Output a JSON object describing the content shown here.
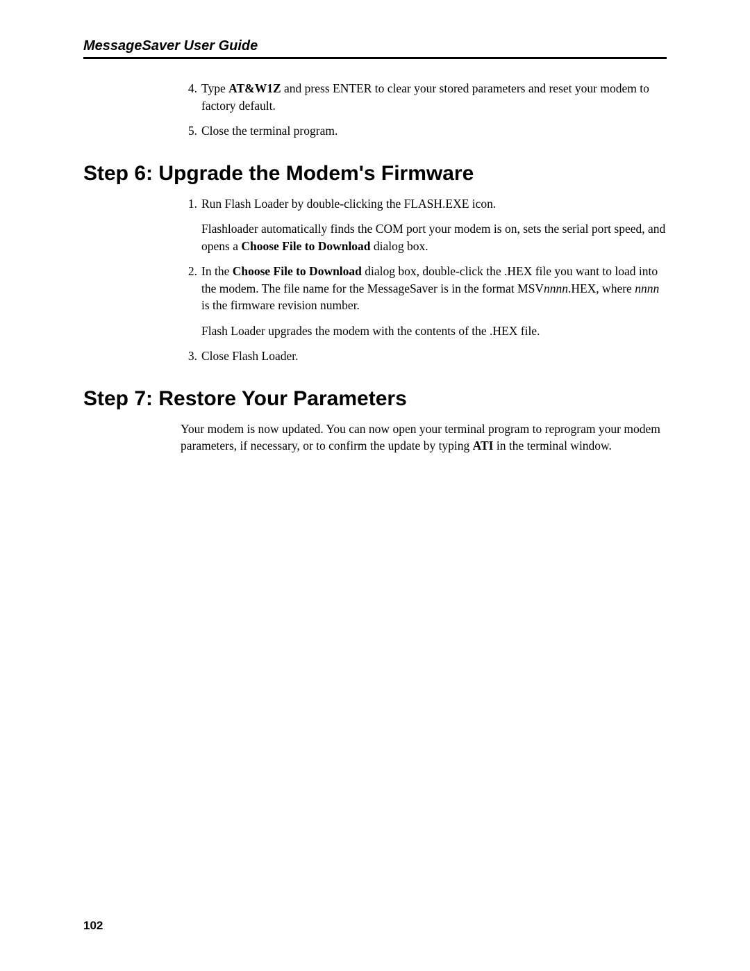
{
  "header": {
    "title": "MessageSaver User Guide"
  },
  "prelist": {
    "item4_num": "4.",
    "item4_pre": "Type ",
    "item4_cmd": "AT&W1Z",
    "item4_post": " and press ENTER to clear your stored parameters and reset your modem to factory default.",
    "item5_num": "5.",
    "item5_text": "Close the terminal program."
  },
  "step6": {
    "heading": "Step 6: Upgrade the Modem's Firmware",
    "item1_num": "1.",
    "item1_p1": "Run Flash Loader by double-clicking the FLASH.EXE icon.",
    "item1_p2_pre": "Flashloader automatically finds the COM port your modem is on, sets the serial port speed, and opens a ",
    "item1_p2_bold": "Choose File to Download",
    "item1_p2_post": " dialog box.",
    "item2_num": "2.",
    "item2_p1_pre": "In the ",
    "item2_p1_bold": "Choose File to Download",
    "item2_p1_mid": " dialog box, double-click the .HEX file you want to load into the modem. The file name for the MessageSaver is in the format MSV",
    "item2_p1_it1": "nnnn",
    "item2_p1_mid2": ".HEX, where ",
    "item2_p1_it2": "nnnn",
    "item2_p1_post": " is the firmware revision number.",
    "item2_p2": "Flash Loader upgrades the modem with the contents of the .HEX file.",
    "item3_num": "3.",
    "item3_text": "Close Flash Loader."
  },
  "step7": {
    "heading": "Step 7: Restore Your Parameters",
    "para_pre": "Your modem is now updated. You can now open your terminal program to reprogram your modem parameters, if necessary, or to confirm the update by typing ",
    "para_bold": "ATI",
    "para_post": " in the terminal window."
  },
  "footer": {
    "page_number": "102"
  }
}
